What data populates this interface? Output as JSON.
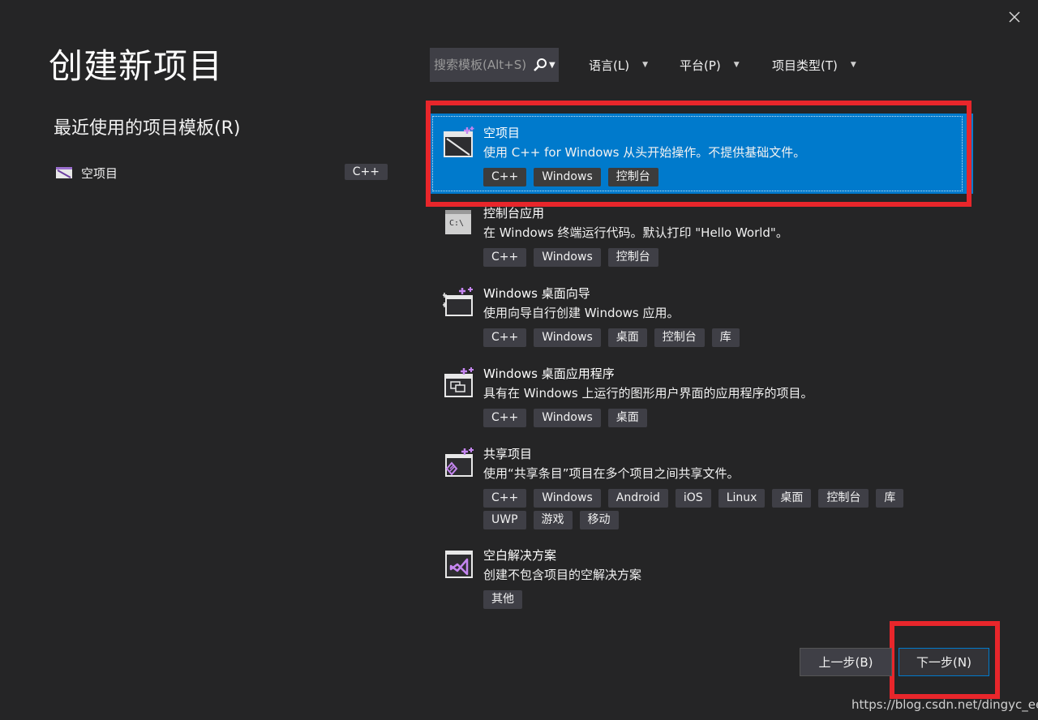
{
  "page": {
    "title": "创建新项目",
    "recent_heading": "最近使用的项目模板(R)"
  },
  "recent": [
    {
      "label": "空项目",
      "tag": "C++"
    }
  ],
  "search": {
    "placeholder": "搜索模板(Alt+S)"
  },
  "filters": [
    {
      "label": "语言(L)"
    },
    {
      "label": "平台(P)"
    },
    {
      "label": "项目类型(T)"
    }
  ],
  "templates": [
    {
      "name": "空项目",
      "desc": "使用 C++ for Windows 从头开始操作。不提供基础文件。",
      "tags": [
        "C++",
        "Windows",
        "控制台"
      ],
      "icon": "empty-project-icon",
      "selected": true
    },
    {
      "name": "控制台应用",
      "desc": "在 Windows 终端运行代码。默认打印 \"Hello World\"。",
      "tags": [
        "C++",
        "Windows",
        "控制台"
      ],
      "icon": "console-app-icon",
      "selected": false
    },
    {
      "name": "Windows 桌面向导",
      "desc": "使用向导自行创建 Windows 应用。",
      "tags": [
        "C++",
        "Windows",
        "桌面",
        "控制台",
        "库"
      ],
      "icon": "desktop-wizard-icon",
      "selected": false
    },
    {
      "name": "Windows 桌面应用程序",
      "desc": "具有在 Windows 上运行的图形用户界面的应用程序的项目。",
      "tags": [
        "C++",
        "Windows",
        "桌面"
      ],
      "icon": "desktop-app-icon",
      "selected": false
    },
    {
      "name": "共享项目",
      "desc": "使用“共享条目”项目在多个项目之间共享文件。",
      "tags": [
        "C++",
        "Windows",
        "Android",
        "iOS",
        "Linux",
        "桌面",
        "控制台",
        "库",
        "UWP",
        "游戏",
        "移动"
      ],
      "icon": "shared-project-icon",
      "selected": false
    },
    {
      "name": "空白解决方案",
      "desc": "创建不包含项目的空解决方案",
      "tags": [
        "其他"
      ],
      "icon": "blank-solution-icon",
      "selected": false
    }
  ],
  "buttons": {
    "back": "上一步(B)",
    "next": "下一步(N)"
  },
  "watermark": "https://blog.csdn.net/dingyc_ee",
  "colors": {
    "background": "#252526",
    "accent": "#007acc",
    "highlight": "#e8262b",
    "tag": "#3f3f46"
  }
}
